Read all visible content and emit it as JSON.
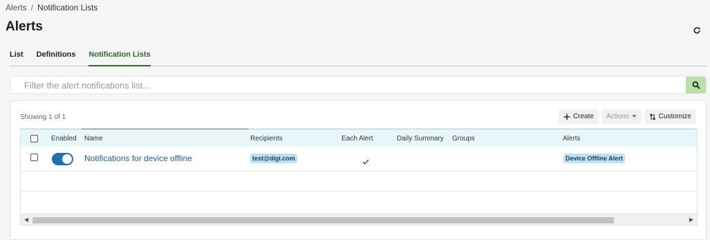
{
  "breadcrumb": {
    "parent": "Alerts",
    "separator": "/",
    "current": "Notification Lists"
  },
  "page": {
    "title": "Alerts"
  },
  "tabs": [
    {
      "label": "List",
      "active": false
    },
    {
      "label": "Definitions",
      "active": false
    },
    {
      "label": "Notification Lists",
      "active": true
    }
  ],
  "search": {
    "placeholder": "Filter the alert notifications list...",
    "value": ""
  },
  "summary": {
    "showing": "Showing 1 of 1"
  },
  "toolbar": {
    "create_label": "Create",
    "actions_label": "Actions",
    "customize_label": "Customize"
  },
  "table": {
    "columns": {
      "enabled": "Enabled",
      "name": "Name",
      "recipients": "Recipients",
      "each_alert": "Each Alert",
      "daily_summary": "Daily Summary",
      "groups": "Groups",
      "alerts": "Alerts"
    },
    "rows": [
      {
        "checked": false,
        "enabled": true,
        "name": "Notifications for device offline",
        "recipients": "test@digi.com",
        "each_alert": true,
        "daily_summary": "",
        "groups": "",
        "alerts": "Device Offline Alert"
      }
    ]
  },
  "colors": {
    "accent_green": "#2d6b2b",
    "toggle_blue": "#1f6fb2",
    "link_blue": "#1f5e8d",
    "badge_bg": "#bde1f3"
  }
}
